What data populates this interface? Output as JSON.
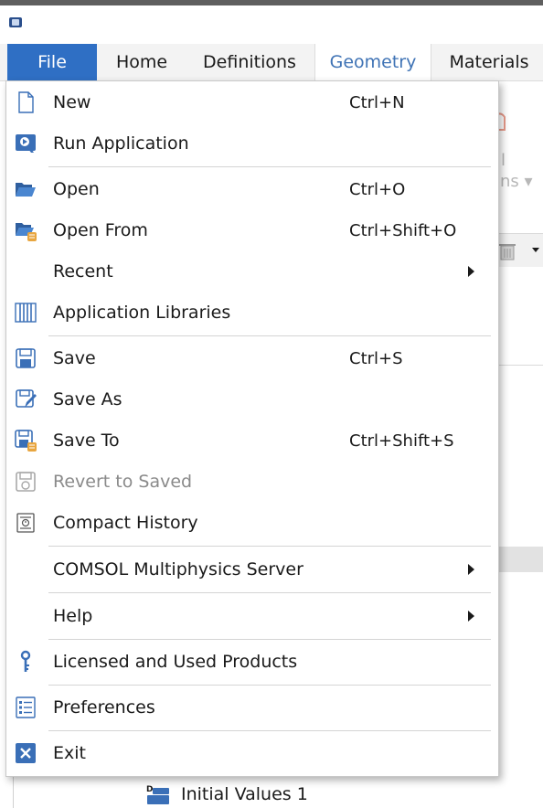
{
  "ribbon": {
    "tabs": [
      "File",
      "Home",
      "Definitions",
      "Geometry",
      "Materials"
    ],
    "ghost": {
      "l": "l",
      "ons": "ons ▾"
    }
  },
  "file_menu": {
    "items": [
      {
        "label": "New",
        "shortcut": "Ctrl+N",
        "icon": "new-file-icon"
      },
      {
        "label": "Run Application",
        "shortcut": "",
        "icon": "run-application-icon"
      },
      {
        "label": "Open",
        "shortcut": "Ctrl+O",
        "icon": "open-folder-icon"
      },
      {
        "label": "Open From",
        "shortcut": "Ctrl+Shift+O",
        "icon": "open-from-icon"
      },
      {
        "label": "Recent",
        "shortcut": "",
        "icon": ""
      },
      {
        "label": "Application Libraries",
        "shortcut": "",
        "icon": "application-libraries-icon"
      },
      {
        "label": "Save",
        "shortcut": "Ctrl+S",
        "icon": "save-icon"
      },
      {
        "label": "Save As",
        "shortcut": "",
        "icon": "save-as-icon"
      },
      {
        "label": "Save To",
        "shortcut": "Ctrl+Shift+S",
        "icon": "save-to-icon"
      },
      {
        "label": "Revert to Saved",
        "shortcut": "",
        "icon": "revert-icon",
        "disabled": true
      },
      {
        "label": "Compact History",
        "shortcut": "",
        "icon": "compact-history-icon"
      },
      {
        "label": "COMSOL Multiphysics Server",
        "shortcut": "",
        "icon": ""
      },
      {
        "label": "Help",
        "shortcut": "",
        "icon": ""
      },
      {
        "label": "Licensed and Used Products",
        "shortcut": "",
        "icon": "key-icon"
      },
      {
        "label": "Preferences",
        "shortcut": "",
        "icon": "preferences-icon"
      },
      {
        "label": "Exit",
        "shortcut": "",
        "icon": "exit-icon"
      }
    ]
  },
  "tree": {
    "item_label": "Initial Values 1"
  },
  "colors": {
    "file_tab": "#2f6fc4",
    "geometry_tab_text": "#3f73b5",
    "icon_blue": "#3a6fb7",
    "icon_orange": "#e8a640"
  }
}
